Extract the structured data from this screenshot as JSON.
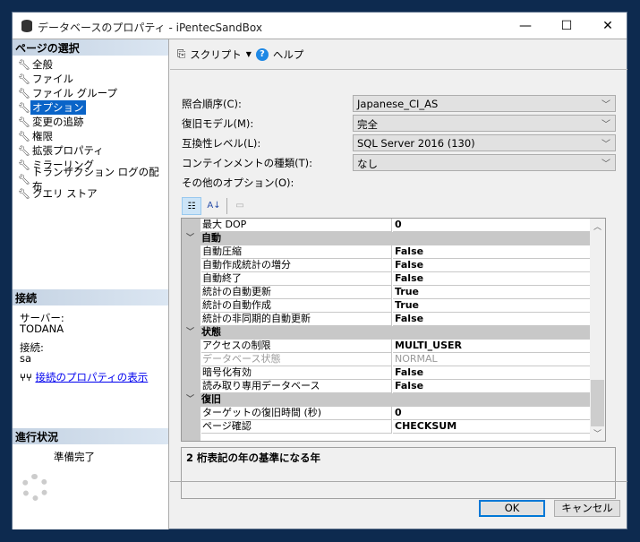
{
  "window": {
    "title": "データベースのプロパティ - iPentecSandBox",
    "minimize": "—",
    "maximize": "☐",
    "close": "✕"
  },
  "left": {
    "select_header": "ページの選択",
    "pages": [
      "全般",
      "ファイル",
      "ファイル グループ",
      "オプション",
      "変更の追跡",
      "権限",
      "拡張プロパティ",
      "ミラーリング",
      "トランザクション ログの配布",
      "クエリ ストア"
    ],
    "selected_index": 3,
    "connection_header": "接続",
    "server_label": "サーバー:",
    "server_value": "TODANA",
    "conn_label": "接続:",
    "conn_value": "sa",
    "conn_link": "接続のプロパティの表示",
    "progress_header": "進行状況",
    "progress_status": "準備完了"
  },
  "toolbar": {
    "script": "スクリプト",
    "help": "ヘルプ"
  },
  "form": {
    "collation_label": "照合順序(C):",
    "collation_value": "Japanese_CI_AS",
    "recovery_label": "復旧モデル(M):",
    "recovery_value": "完全",
    "compat_label": "互換性レベル(L):",
    "compat_value": "SQL Server 2016 (130)",
    "containment_label": "コンテインメントの種類(T):",
    "containment_value": "なし",
    "other_label": "その他のオプション(O):"
  },
  "grid": {
    "rows": [
      {
        "type": "prop",
        "name": "最大 DOP",
        "value": "0"
      },
      {
        "type": "cat",
        "name": "自動"
      },
      {
        "type": "prop",
        "name": "自動圧縮",
        "value": "False"
      },
      {
        "type": "prop",
        "name": "自動作成統計の増分",
        "value": "False"
      },
      {
        "type": "prop",
        "name": "自動終了",
        "value": "False"
      },
      {
        "type": "prop",
        "name": "統計の自動更新",
        "value": "True"
      },
      {
        "type": "prop",
        "name": "統計の自動作成",
        "value": "True"
      },
      {
        "type": "prop",
        "name": "統計の非同期的自動更新",
        "value": "False"
      },
      {
        "type": "cat",
        "name": "状態"
      },
      {
        "type": "prop",
        "name": "アクセスの制限",
        "value": "MULTI_USER"
      },
      {
        "type": "dis",
        "name": "データベース状態",
        "value": "NORMAL"
      },
      {
        "type": "prop",
        "name": "暗号化有効",
        "value": "False"
      },
      {
        "type": "prop",
        "name": "読み取り専用データベース",
        "value": "False"
      },
      {
        "type": "cat",
        "name": "復旧"
      },
      {
        "type": "prop",
        "name": "ターゲットの復旧時間 (秒)",
        "value": "0"
      },
      {
        "type": "prop",
        "name": "ページ確認",
        "value": "CHECKSUM"
      }
    ],
    "description": "2 桁表記の年の基準になる年"
  },
  "buttons": {
    "ok": "OK",
    "cancel": "キャンセル"
  }
}
